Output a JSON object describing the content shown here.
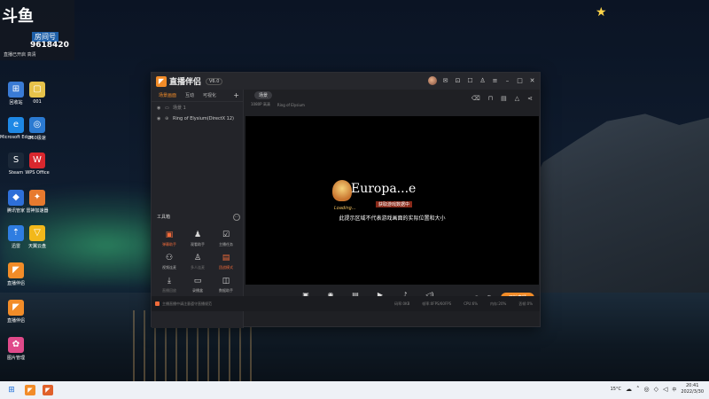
{
  "desktop": {
    "overlay": {
      "logo": "斗鱼",
      "room_label": "房间号",
      "room_id": "9618420",
      "note": "直播已开启 高清"
    },
    "icons": [
      {
        "name": "icon-a",
        "glyph": "⊞",
        "label": "回收站",
        "color": "#3a7bd5"
      },
      {
        "name": "icon-b",
        "glyph": "▢",
        "label": "001",
        "color": "#e6c24a"
      },
      {
        "name": "edge",
        "glyph": "e",
        "label": "Microsoft Edge",
        "color": "#1e88e5"
      },
      {
        "name": "360",
        "glyph": "◎",
        "label": "360极速",
        "color": "#2b7ad1"
      },
      {
        "name": "steam",
        "glyph": "S",
        "label": "Steam",
        "color": "#1b2838"
      },
      {
        "name": "wps",
        "glyph": "W",
        "label": "WPS Office",
        "color": "#d9272e"
      },
      {
        "name": "security",
        "glyph": "◆",
        "label": "腾讯管家",
        "color": "#2e6fd8"
      },
      {
        "name": "game",
        "glyph": "✦",
        "label": "雷神加速器",
        "color": "#e77a2e"
      },
      {
        "name": "arrow",
        "glyph": "⇡",
        "label": "迅雷",
        "color": "#2f7de1"
      },
      {
        "name": "nova",
        "glyph": "▽",
        "label": "天翼云盘",
        "color": "#f2b81b"
      },
      {
        "name": "live1",
        "glyph": "◤",
        "label": "直播伴侣",
        "color": "#f28c28"
      },
      {
        "name": "live2",
        "glyph": "◤",
        "label": "直播伴侣",
        "color": "#f28c28"
      },
      {
        "name": "colorful",
        "glyph": "✿",
        "label": "图片管理",
        "color": "#e04a8a"
      }
    ]
  },
  "window": {
    "title": "直播伴侣",
    "version": "V6.0",
    "left_tabs": [
      "场景画面",
      "互动",
      "可视化"
    ],
    "scene_label": "场景 1",
    "source_name": "Ring of Elysium(DirectX 12)",
    "tools_title": "工具箱",
    "tools": [
      {
        "label": "弹幕助手",
        "glyph": "▣",
        "style": "orange"
      },
      {
        "label": "观看助手",
        "glyph": "♟",
        "style": ""
      },
      {
        "label": "主播任务",
        "glyph": "☑",
        "style": ""
      },
      {
        "label": "视频连麦",
        "glyph": "⚇",
        "style": ""
      },
      {
        "label": "多人连麦",
        "glyph": "♙",
        "style": "dim"
      },
      {
        "label": "团战模式",
        "glyph": "▤",
        "style": "orange"
      },
      {
        "label": "直播回放",
        "glyph": "⤓",
        "style": "dim"
      },
      {
        "label": "录播盒",
        "glyph": "▭",
        "style": ""
      },
      {
        "label": "数据助手",
        "glyph": "◫",
        "style": ""
      },
      {
        "label": "",
        "glyph": "▰",
        "style": ""
      },
      {
        "label": "",
        "glyph": "",
        "style": ""
      },
      {
        "label": "",
        "glyph": "◍",
        "style": ""
      }
    ],
    "scene_chip": "场景",
    "source_info": [
      "1080P 高清",
      "Ring of Elysium"
    ],
    "preview": {
      "game_title": "Europa...e",
      "badge": "获取游戏数据中",
      "loading": "Loading...",
      "hint": "此提示区域不代表游戏画面的实际位置和大小"
    },
    "controls": [
      {
        "label": "直播弹幕",
        "glyph": "▣"
      },
      {
        "label": "摄像头",
        "glyph": "◉"
      },
      {
        "label": "手机投屏",
        "glyph": "▤"
      },
      {
        "label": "多媒体",
        "glyph": "▶"
      },
      {
        "label": "麦克风",
        "glyph": "♪"
      },
      {
        "label": "扬声器",
        "glyph": "◁)"
      }
    ],
    "start_label": "开始直播",
    "status_left": "主播直播中请注意遵守直播规范",
    "status_right": [
      "码率:0KB",
      "帧率:0FPS/60FPS",
      "CPU:6%",
      "内存:20%",
      "丢帧:0%"
    ]
  },
  "taskbar": {
    "weather": "15°C",
    "time": "20:41",
    "date": "2022/3/30",
    "ime": "中"
  }
}
